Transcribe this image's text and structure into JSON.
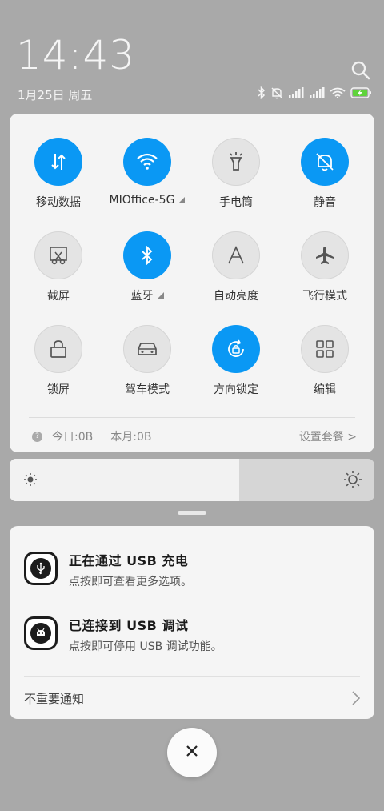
{
  "status": {
    "time": "14:43",
    "date": "1月25日 周五",
    "battery_color": "#5fd33b"
  },
  "quick_settings": {
    "accent": "#0a98f4",
    "tiles": [
      {
        "label": "移动数据",
        "icon": "mobile-data-icon",
        "on": true
      },
      {
        "label": "MIOffice-5G",
        "icon": "wifi-icon",
        "on": true,
        "more": true
      },
      {
        "label": "手电筒",
        "icon": "flashlight-icon",
        "on": false
      },
      {
        "label": "静音",
        "icon": "mute-bell-icon",
        "on": true
      },
      {
        "label": "截屏",
        "icon": "screenshot-icon",
        "on": false
      },
      {
        "label": "蓝牙",
        "icon": "bluetooth-icon",
        "on": true,
        "more": true
      },
      {
        "label": "自动亮度",
        "icon": "auto-brightness-icon",
        "on": false
      },
      {
        "label": "飞行模式",
        "icon": "airplane-icon",
        "on": false
      },
      {
        "label": "锁屏",
        "icon": "lock-icon",
        "on": false
      },
      {
        "label": "驾车模式",
        "icon": "car-icon",
        "on": false
      },
      {
        "label": "方向锁定",
        "icon": "rotation-lock-icon",
        "on": true
      },
      {
        "label": "编辑",
        "icon": "grid-edit-icon",
        "on": false
      }
    ],
    "data_today": "今日:0B",
    "data_month": "本月:0B",
    "plan_link": "设置套餐 >"
  },
  "brightness": {
    "level_percent": 63
  },
  "notifications": {
    "items": [
      {
        "title": "正在通过 USB 充电",
        "subtitle": "点按即可查看更多选项。",
        "icon": "usb-icon"
      },
      {
        "title": "已连接到 USB 调试",
        "subtitle": "点按即可停用 USB 调试功能。",
        "icon": "android-debug-icon"
      }
    ],
    "unimportant_label": "不重要通知"
  }
}
